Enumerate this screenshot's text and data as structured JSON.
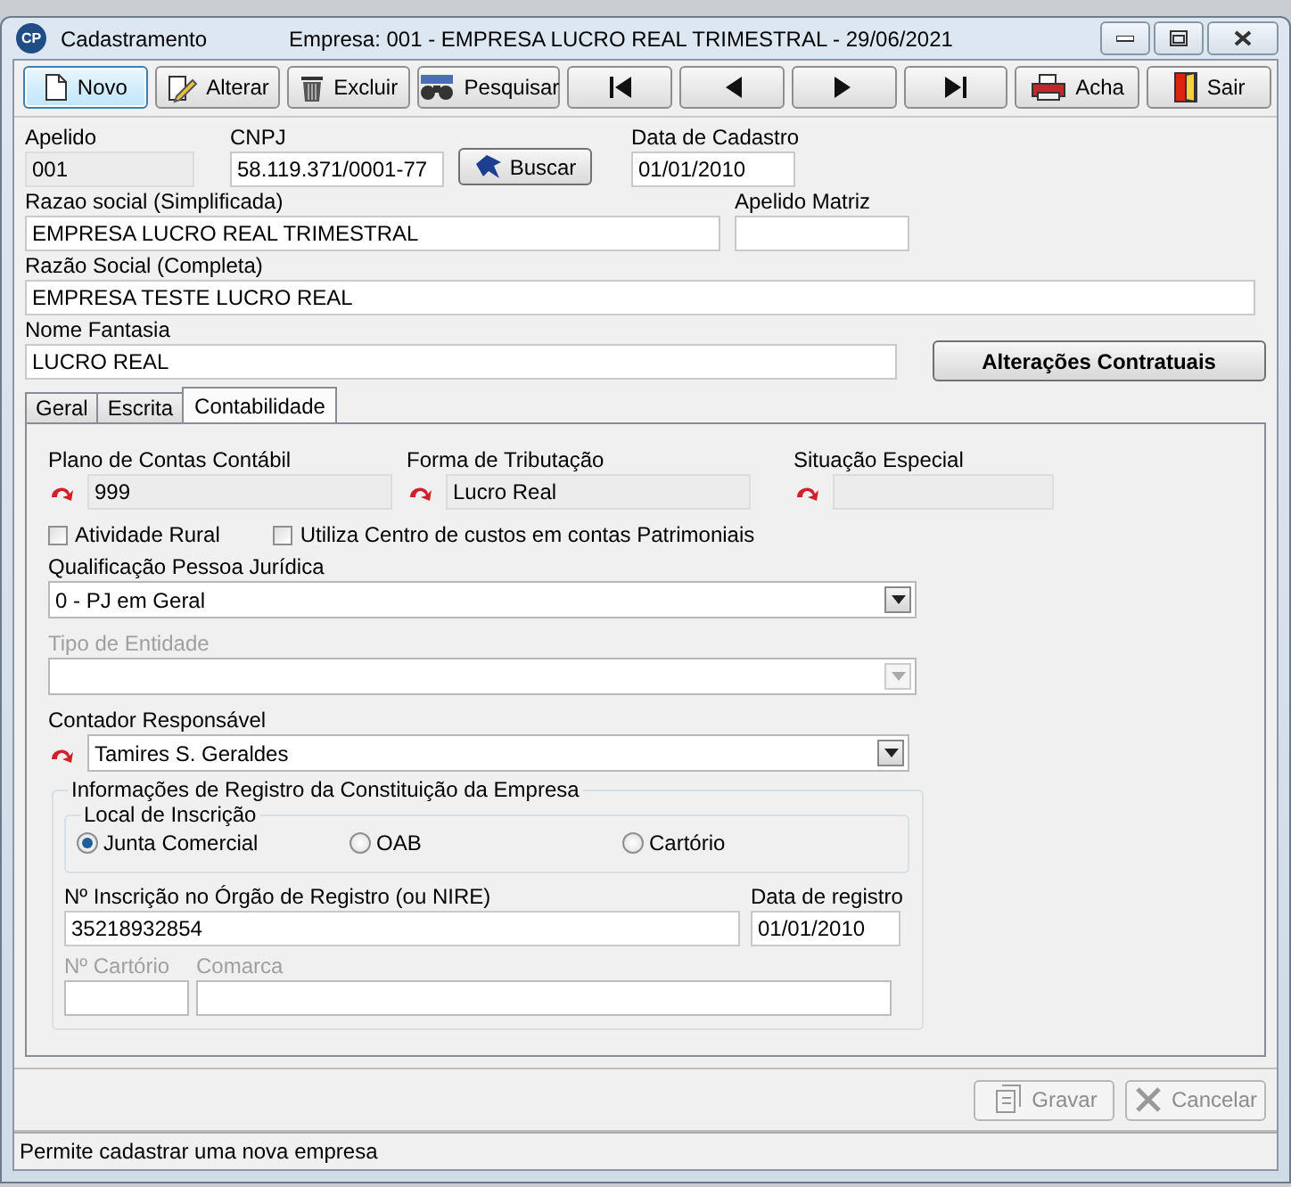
{
  "window": {
    "icon_text": "CP",
    "title": "Cadastramento",
    "subtitle": "Empresa: 001 - EMPRESA LUCRO REAL TRIMESTRAL - 29/06/2021"
  },
  "toolbar": [
    {
      "kind": "new",
      "label": "Novo",
      "focused": true
    },
    {
      "kind": "edit",
      "label": "Alterar",
      "focused": false
    },
    {
      "kind": "delete",
      "label": "Excluir",
      "focused": false
    },
    {
      "kind": "search",
      "label": "Pesquisar",
      "focused": false
    },
    {
      "kind": "first",
      "focused": false
    },
    {
      "kind": "prev",
      "focused": false
    },
    {
      "kind": "next",
      "focused": false
    },
    {
      "kind": "last",
      "focused": false
    },
    {
      "kind": "find",
      "label": "Acha",
      "focused": false
    },
    {
      "kind": "exit",
      "label": "Sair",
      "focused": false
    }
  ],
  "header": {
    "apelido": {
      "label": "Apelido",
      "value": "001",
      "readonly": true
    },
    "cnpj": {
      "label": "CNPJ",
      "value": "58.119.371/0001-77",
      "readonly": false
    },
    "buscar": "Buscar",
    "data_cadastro": {
      "label": "Data de Cadastro",
      "value": "01/01/2010",
      "readonly": false
    },
    "razao_simplificada": {
      "label": "Razao social (Simplificada)",
      "value": "EMPRESA LUCRO REAL TRIMESTRAL",
      "readonly": false
    },
    "apelido_matriz": {
      "label": "Apelido Matriz",
      "readonly": false
    },
    "razao_completa": {
      "label": "Razão Social (Completa)",
      "value": "EMPRESA TESTE LUCRO REAL",
      "readonly": false
    },
    "nome_fantasia": {
      "label": "Nome Fantasia",
      "value": "LUCRO REAL",
      "readonly": false
    },
    "alteracoes": "Alterações Contratuais"
  },
  "tabs": [
    {
      "label": "Geral",
      "selected": false
    },
    {
      "label": "Escrita",
      "selected": false
    },
    {
      "label": "Contabilidade",
      "selected": true
    }
  ],
  "contabilidade": {
    "plano": {
      "label": "Plano de Contas Contábil",
      "value": "999",
      "readonly": true
    },
    "forma": {
      "label": "Forma de Tributação",
      "value": "Lucro Real",
      "readonly": true
    },
    "situacao": {
      "label": "Situação Especial",
      "readonly": true
    },
    "checkboxes": [
      {
        "label": "Atividade Rural",
        "checked": false
      },
      {
        "label": "Utiliza Centro de custos em contas Patrimoniais",
        "checked": false
      }
    ],
    "qualificacao": {
      "label": "Qualificação Pessoa Jurídica",
      "value": "0 - PJ em Geral",
      "disabled": false
    },
    "tipo_entidade": {
      "label": "Tipo de Entidade",
      "disabled": true
    },
    "contador": {
      "label": "Contador Responsável",
      "value": "Tamires S. Geraldes",
      "disabled": false
    },
    "registro": {
      "title": "Informações de Registro da Constituição da Empresa",
      "local_title": "Local de Inscrição",
      "local": [
        {
          "label": "Junta Comercial",
          "selected": true
        },
        {
          "label": "OAB",
          "selected": false
        },
        {
          "label": "Cartório",
          "selected": false
        }
      ],
      "nire": {
        "label": "Nº Inscrição no Órgão de Registro (ou NIRE)",
        "value": "35218932854",
        "disabled": false
      },
      "data_registro": {
        "label": "Data de registro",
        "value": "01/01/2010",
        "disabled": false
      },
      "cartorio": {
        "label": "Nº Cartório",
        "disabled": true
      },
      "comarca": {
        "label": "Comarca",
        "disabled": true
      }
    }
  },
  "footer_buttons": [
    {
      "kind": "save",
      "label": "Gravar",
      "disabled": true
    },
    {
      "kind": "cancel",
      "label": "Cancelar",
      "disabled": true
    }
  ],
  "status_bar": "Permite cadastrar uma nova empresa"
}
